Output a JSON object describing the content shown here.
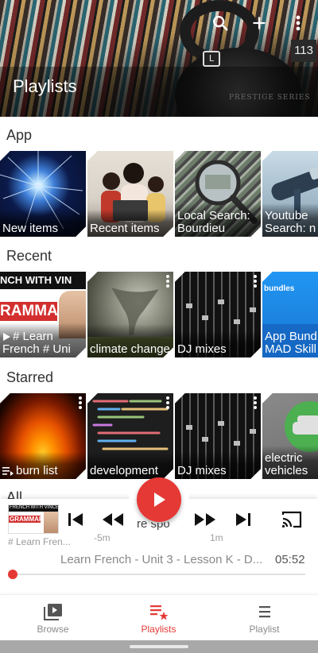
{
  "header": {
    "title": "Playlists",
    "count": "113",
    "record_label": "PRESTIGE SERIES",
    "tag_letter": "L",
    "icons": [
      "search-icon",
      "add-icon",
      "more-vert-icon"
    ]
  },
  "sections": {
    "app": {
      "label": "App",
      "tiles": [
        {
          "caption": "New items",
          "art": "fireworks",
          "colors": [
            "#0b1a4a",
            "#3f7fd8",
            "#9fd3ff"
          ]
        },
        {
          "caption": "Recent items",
          "art": "family",
          "colors": [
            "#d8d2c8",
            "#c0392b",
            "#f3e7dd"
          ]
        },
        {
          "caption": "Local Search: Bourdieu",
          "art": "magnifier",
          "colors": [
            "#3b3b3b",
            "#b8c2c4",
            "#6d7c6a"
          ]
        },
        {
          "caption": "Youtube Search: n",
          "art": "telescope",
          "colors": [
            "#c9dbe6",
            "#6f8aa0",
            "#2c3e50"
          ]
        }
      ]
    },
    "recent": {
      "label": "Recent",
      "tiles": [
        {
          "caption": "# Learn French # Uni",
          "art": "grammar",
          "colors": [
            "#ffffff",
            "#d32f2f",
            "#111111"
          ],
          "text_art": [
            "NCH WITH VIN",
            "RAMMAR"
          ],
          "has_playlist_icon": true
        },
        {
          "caption": "climate change",
          "art": "tornado",
          "colors": [
            "#6b6b60",
            "#a6a89a",
            "#3d3f33"
          ],
          "has_menu": true
        },
        {
          "caption": "DJ mixes",
          "art": "mixer",
          "colors": [
            "#1b1b1b",
            "#5a5a5a",
            "#bdbdbd"
          ],
          "has_menu": true
        },
        {
          "caption": "App Bund MAD Skill",
          "art": "bundles",
          "colors": [
            "#2196f3",
            "#1565c0",
            "#ffffff"
          ],
          "text_art": [
            "bundles"
          ]
        }
      ]
    },
    "starred": {
      "label": "Starred",
      "tiles": [
        {
          "caption": "burn list",
          "art": "fire",
          "colors": [
            "#1a0500",
            "#e65100",
            "#ffca28"
          ],
          "has_menu": true,
          "has_playlist_icon": true
        },
        {
          "caption": "development",
          "art": "code",
          "colors": [
            "#1e1e1e",
            "#e06c75",
            "#98c379"
          ],
          "has_menu": true
        },
        {
          "caption": "DJ mixes",
          "art": "mixer",
          "colors": [
            "#1b1b1b",
            "#5a5a5a",
            "#bdbdbd"
          ],
          "has_menu": true
        },
        {
          "caption": "electric vehicles",
          "art": "ev",
          "colors": [
            "#4caf50",
            "#2e7d32",
            "#e0e0e0"
          ],
          "has_menu": true
        }
      ]
    },
    "all": {
      "label": "All"
    }
  },
  "player": {
    "thumb_title": "# Learn Fren...",
    "thumb_text": [
      "FRENCH WITH VINCENT",
      "GRAMMAR"
    ],
    "rewind_label": "-5m",
    "forward_label": "1m",
    "marquee_text": "re spo",
    "track_title": "Learn French - Unit 3 - Lesson K - D...",
    "track_time": "05:52",
    "progress": 0.0,
    "accent": "#e53935",
    "icons": [
      "skip-previous-icon",
      "rewind-icon",
      "play-icon",
      "fast-forward-icon",
      "skip-next-icon",
      "cast-icon"
    ]
  },
  "bottom_nav": {
    "items": [
      {
        "label": "Browse",
        "icon": "browse-icon",
        "active": false
      },
      {
        "label": "Playlists",
        "icon": "playlists-icon",
        "active": true
      },
      {
        "label": "Playlist",
        "icon": "playlist-icon",
        "active": false
      }
    ]
  }
}
